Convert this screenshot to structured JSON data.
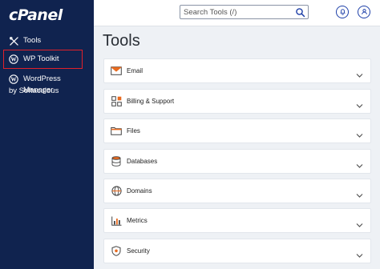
{
  "brand": {
    "logo_text": "cPanel"
  },
  "sidebar": {
    "items": [
      {
        "label": "Tools",
        "icon": "tools-icon"
      },
      {
        "label": "WP Toolkit",
        "icon": "wordpress-icon",
        "highlighted": true
      },
      {
        "label_line1": "WordPress Manager",
        "label_line2": "by Softaculous",
        "icon": "wordpress-icon"
      }
    ]
  },
  "topbar": {
    "search_placeholder": "Search Tools (/)",
    "search_icon": "search-icon",
    "notifications_icon": "bell-icon",
    "user_icon": "user-icon"
  },
  "main": {
    "title": "Tools",
    "sections": [
      {
        "label": "Email",
        "icon": "envelope-icon"
      },
      {
        "label": "Billing & Support",
        "icon": "grid-icon"
      },
      {
        "label": "Files",
        "icon": "folder-icon"
      },
      {
        "label": "Databases",
        "icon": "database-icon"
      },
      {
        "label": "Domains",
        "icon": "globe-icon"
      },
      {
        "label": "Metrics",
        "icon": "bar-chart-icon"
      },
      {
        "label": "Security",
        "icon": "shield-icon"
      }
    ]
  },
  "colors": {
    "sidebar_bg": "#10234f",
    "highlight_border": "#e0202a",
    "accent": "#1d3fa8",
    "icon_orange": "#e86a1f"
  }
}
